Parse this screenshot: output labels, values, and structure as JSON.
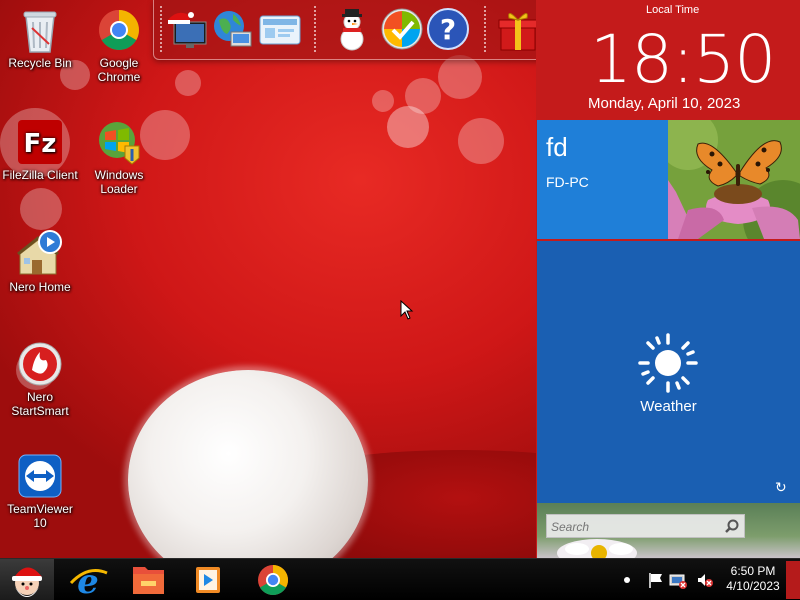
{
  "desktop": {
    "icons": [
      {
        "label": "Recycle Bin",
        "icon": "recycle-bin-icon"
      },
      {
        "label": "Google Chrome",
        "icon": "chrome-icon"
      },
      {
        "label": "FileZilla Client",
        "icon": "filezilla-icon"
      },
      {
        "label": "Windows Loader",
        "icon": "windows-loader-icon"
      },
      {
        "label": "Nero Home",
        "icon": "nero-home-icon"
      },
      {
        "label": "Nero StartSmart",
        "icon": "nero-startsmart-icon"
      },
      {
        "label": "TeamViewer 10",
        "icon": "teamviewer-icon"
      }
    ]
  },
  "dock": {
    "items": [
      "santa-monitor-icon",
      "network-globe-icon",
      "control-panel-icon",
      "snowman-icon",
      "windows-update-icon",
      "help-icon",
      "gift-icon",
      "folder-icon",
      "recycle-bin-icon"
    ]
  },
  "metro": {
    "clock": {
      "caption": "Local Time",
      "time": "18:50",
      "date": "Monday, April 10, 2023"
    },
    "user_tile": {
      "name": "fd",
      "computer": "FD-PC"
    },
    "weather_tile": {
      "label": "Weather",
      "refresh_icon": "↻"
    },
    "search": {
      "placeholder": "Search"
    }
  },
  "taskbar": {
    "pinned": [
      "santa-start-icon",
      "internet-explorer-icon",
      "file-explorer-icon",
      "media-player-icon",
      "chrome-icon"
    ],
    "tray": {
      "time": "6:50 PM",
      "date": "4/10/2023"
    }
  },
  "colors": {
    "metro_bg": "#c41b1b",
    "tile_blue": "#1f7fd8",
    "tile_weather": "#1a5fb2",
    "taskbar": "#000000"
  }
}
